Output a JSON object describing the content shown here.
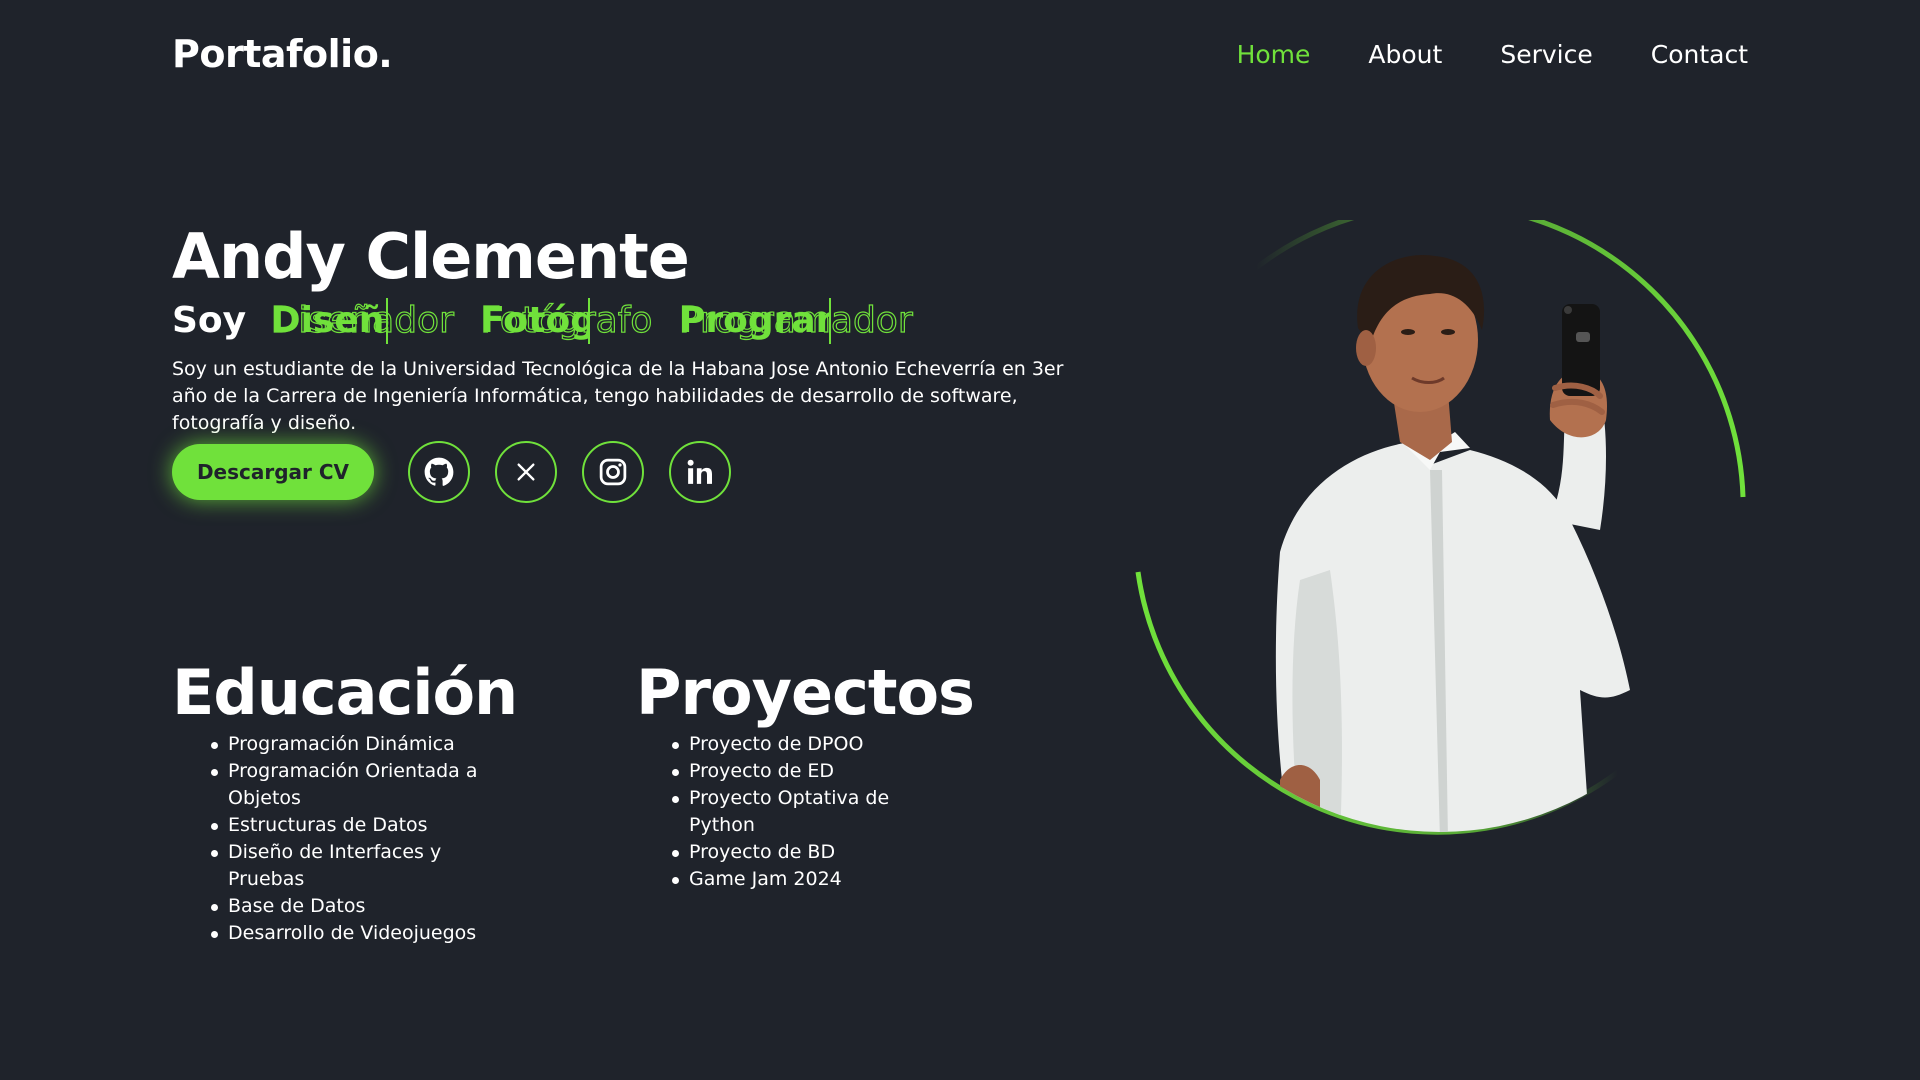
{
  "header": {
    "logo": "Portafolio.",
    "nav": [
      {
        "label": "Home",
        "active": true
      },
      {
        "label": "About",
        "active": false
      },
      {
        "label": "Service",
        "active": false
      },
      {
        "label": "Contact",
        "active": false
      }
    ]
  },
  "hero": {
    "name": "Andy Clemente",
    "roles_prefix": "Soy",
    "roles": [
      "Diseñador",
      "Fotógrafo",
      "Programador"
    ],
    "description": "Soy un estudiante de la Universidad Tecnológica de la Habana Jose Antonio Echeverría en 3er año de la Carrera de Ingeniería Informática, tengo habilidades de desarrollo de software, fotografía y diseño.",
    "cv_button": "Descargar CV",
    "socials": [
      {
        "icon": "github-icon"
      },
      {
        "icon": "x-icon"
      },
      {
        "icon": "instagram-icon"
      },
      {
        "icon": "linkedin-icon"
      }
    ]
  },
  "education": {
    "title": "Educación",
    "items": [
      "Programación Dinámica",
      "Programación Orientada a Objetos",
      "Estructuras de Datos",
      "Diseño de Interfaces y Pruebas",
      "Base de Datos",
      "Desarrollo de Videojuegos"
    ]
  },
  "projects": {
    "title": "Proyectos",
    "items": [
      "Proyecto de DPOO",
      "Proyecto de ED",
      "Proyecto Optativa de Python",
      "Proyecto de BD",
      "Game Jam 2024"
    ]
  },
  "colors": {
    "accent": "#70e13b",
    "background": "#1f232b",
    "text": "#ffffff"
  }
}
